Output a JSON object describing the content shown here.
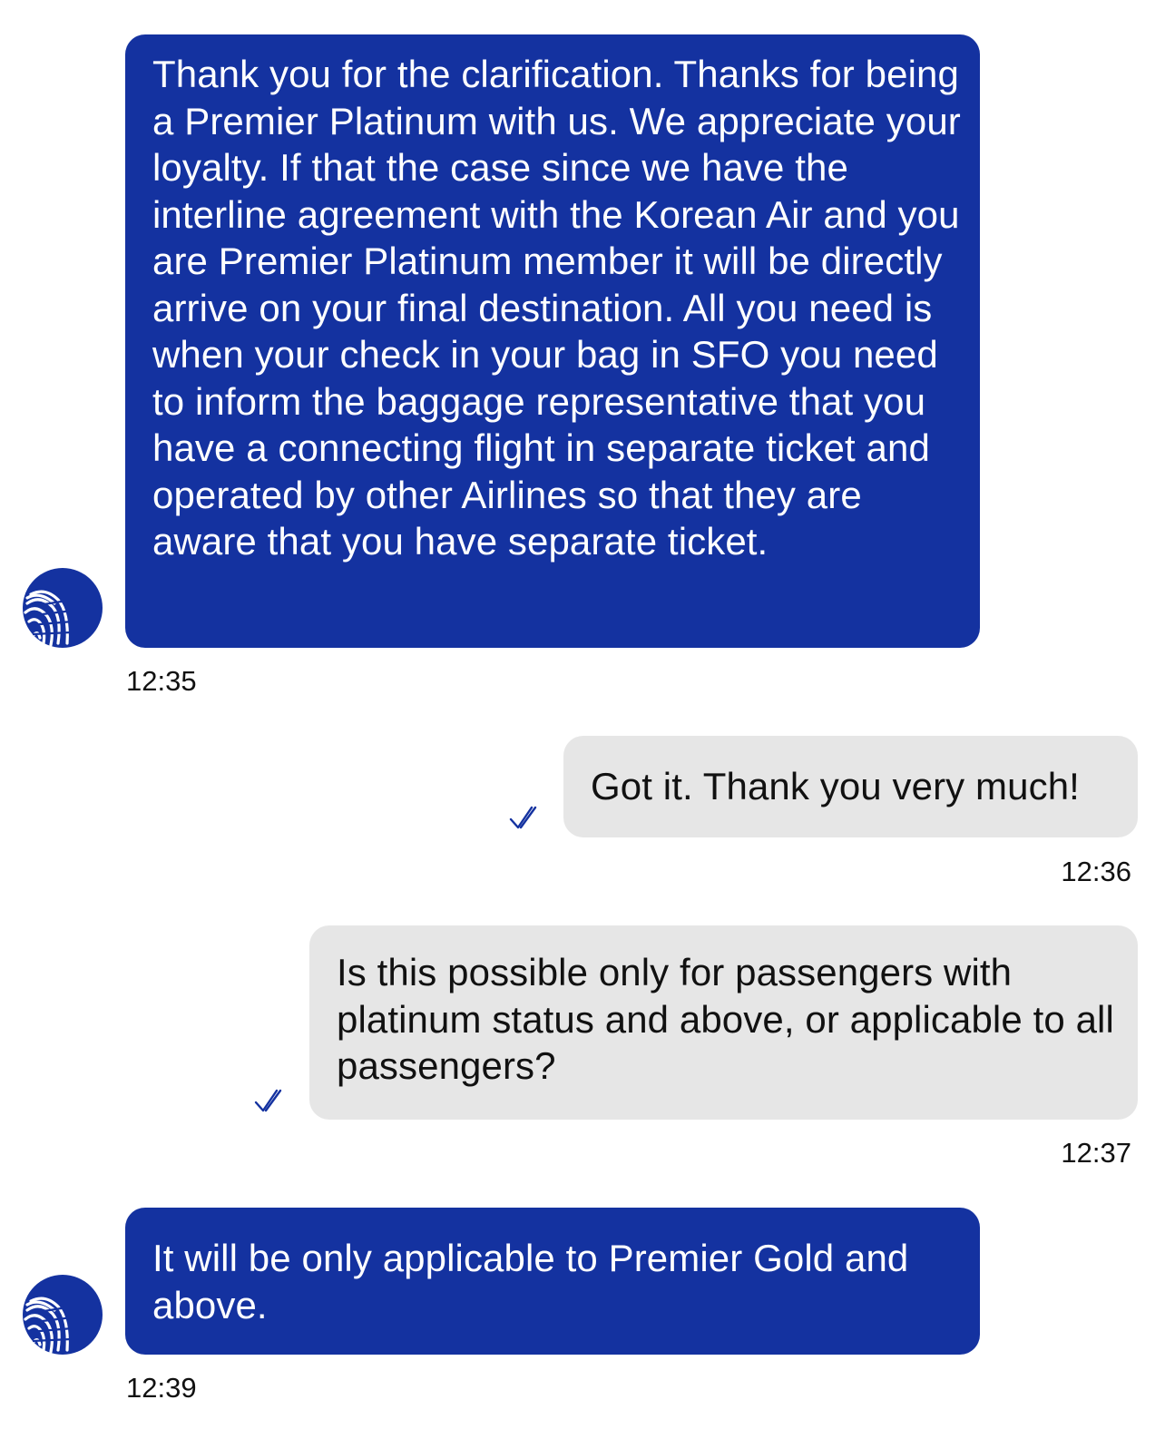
{
  "conversation": {
    "messages": [
      {
        "sender": "agent",
        "text": "Thank you for the clarification. Thanks for being a Premier Platinum with us. We appreciate your loyalty. If that the case since we have the interline agreement with the Korean Air and you are Premier Platinum member it will be directly arrive on your final destination. All you need is when your check in your bag in SFO you need to inform the baggage representative that you have a connecting flight in separate ticket and operated by other Airlines so that they are aware that you have separate ticket.",
        "time": "12:35",
        "avatar_icon": "united-globe-logo-icon"
      },
      {
        "sender": "user",
        "text": "Got it. Thank you very much!",
        "time": "12:36",
        "status_icon": "double-check-icon"
      },
      {
        "sender": "user",
        "text": "Is this possible only for passengers with platinum status and above, or applicable to all passengers?",
        "time": "12:37",
        "status_icon": "double-check-icon"
      },
      {
        "sender": "agent",
        "text": "It will be only applicable to Premier Gold and above.",
        "time": "12:39",
        "avatar_icon": "united-globe-logo-icon"
      }
    ]
  },
  "colors": {
    "agent_bubble": "#1432a0",
    "user_bubble": "#e6e6e6",
    "check_mark": "#1432a0"
  }
}
